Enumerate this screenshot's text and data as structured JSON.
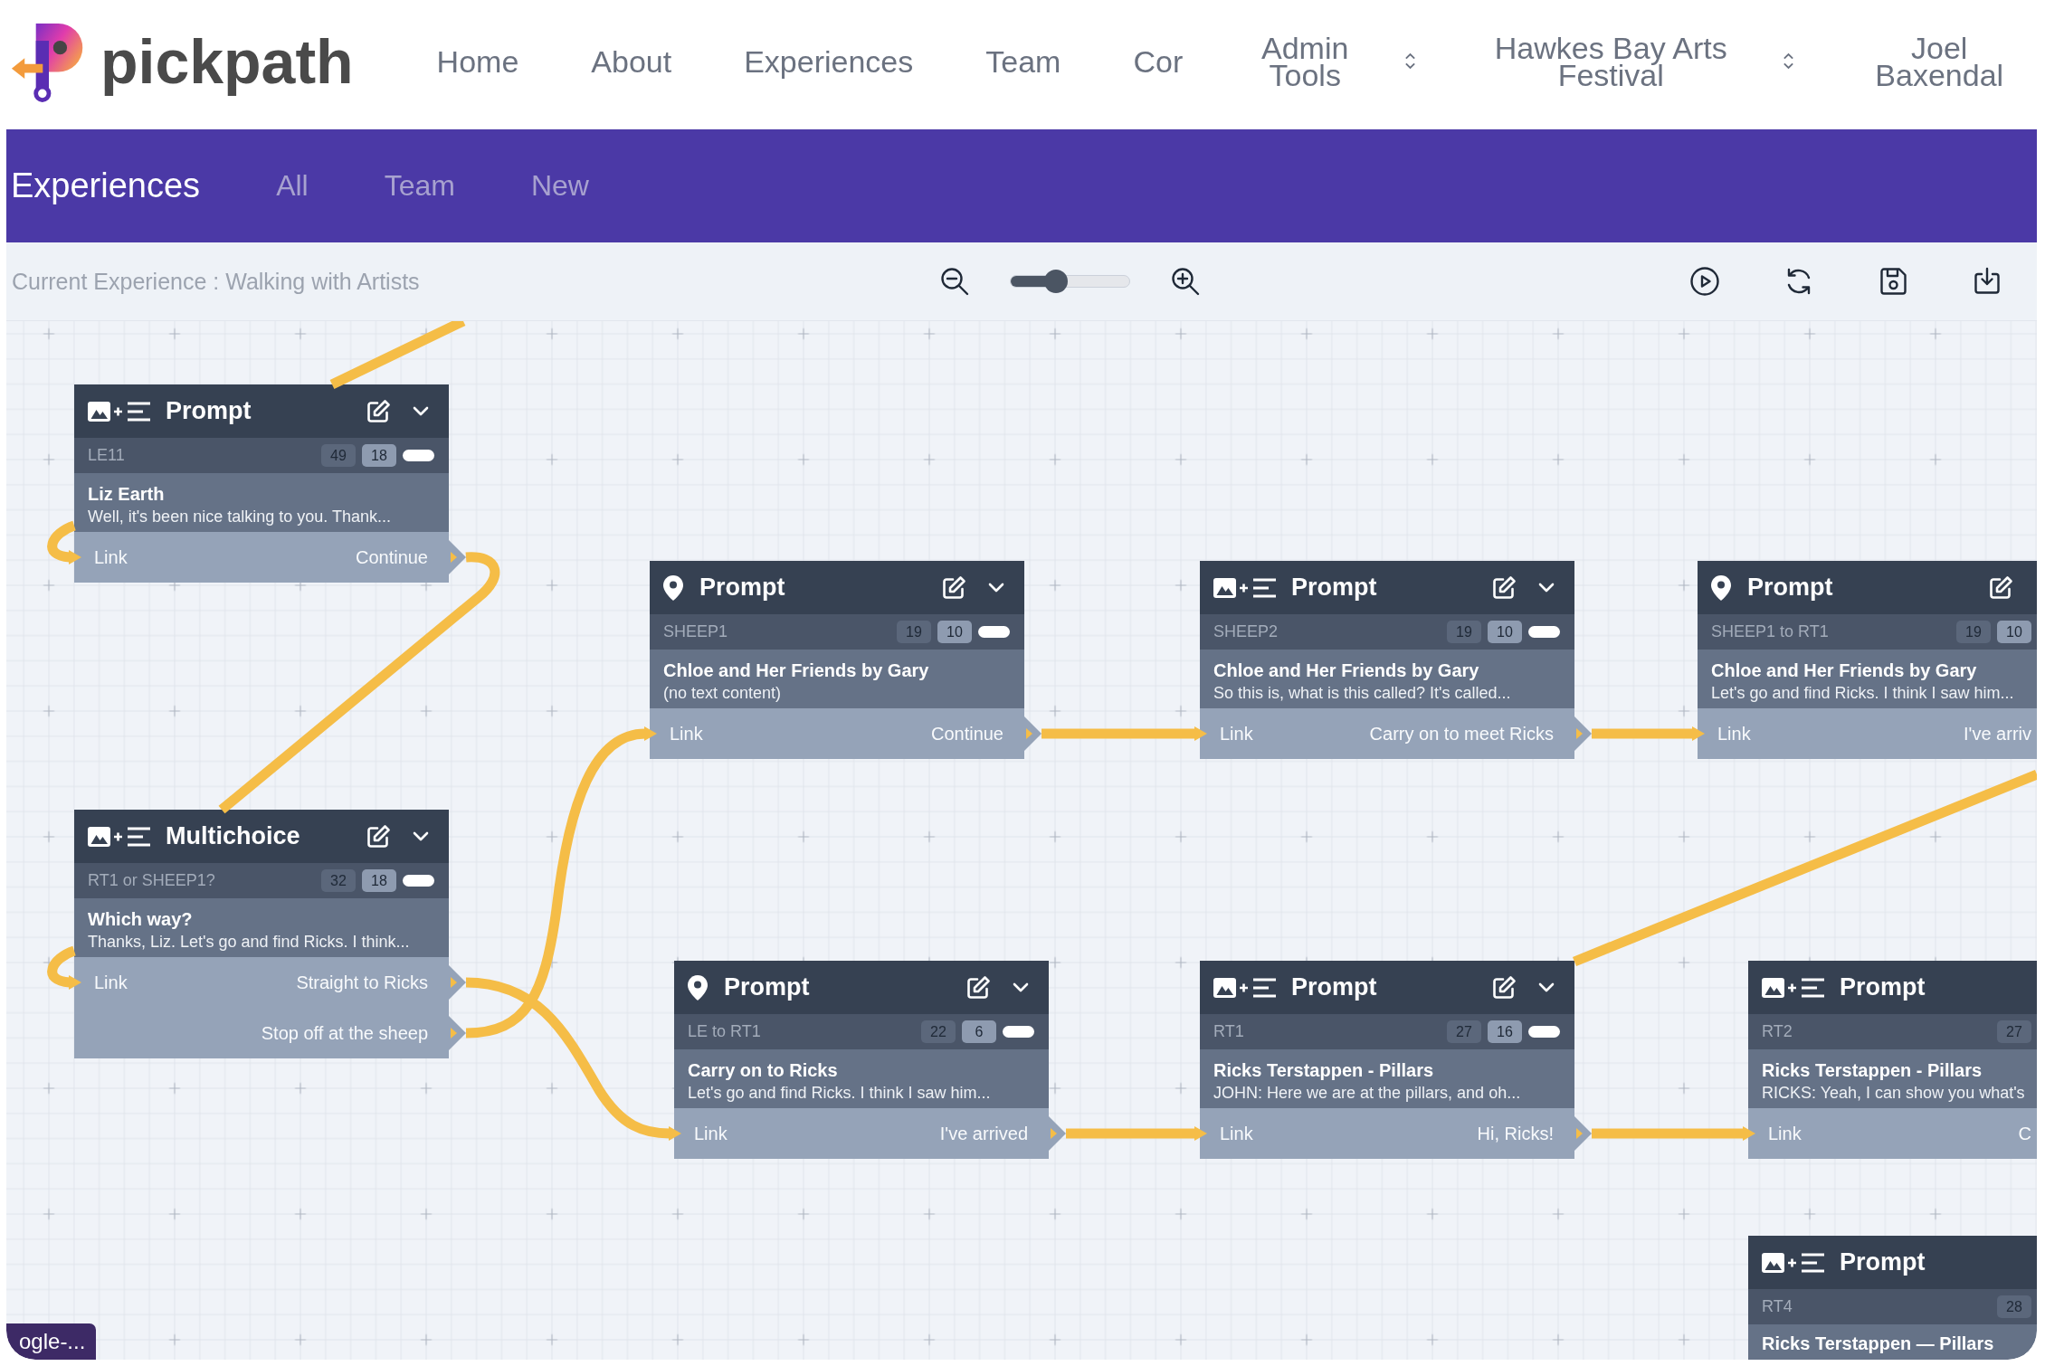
{
  "header": {
    "brand": "pickpath",
    "nav": [
      {
        "label": "Home",
        "kind": "link"
      },
      {
        "label": "About",
        "kind": "link"
      },
      {
        "label": "Experiences",
        "kind": "link"
      },
      {
        "label": "Team",
        "kind": "link"
      },
      {
        "label": "Cor",
        "kind": "link"
      },
      {
        "label": "Admin Tools",
        "kind": "dropdown"
      },
      {
        "label": "Hawkes Bay Arts Festival",
        "kind": "dropdown"
      },
      {
        "label": "Joel Baxendal",
        "kind": "link"
      }
    ]
  },
  "subnav": {
    "title": "Experiences",
    "tabs": [
      "All",
      "Team",
      "New"
    ]
  },
  "toolbar": {
    "current_experience": "Current Experience : Walking with Artists",
    "zoom": {
      "level": 0.38
    }
  },
  "nodes": [
    {
      "kind": "media",
      "type": "Prompt",
      "code": "LE11",
      "counts": [
        "49",
        "18"
      ],
      "enabled": true,
      "heading": "Liz Earth",
      "text": "Well, it's been nice talking to you. Thank...",
      "links": [
        {
          "label": "Link",
          "option": "Continue"
        }
      ]
    },
    {
      "kind": "location",
      "type": "Prompt",
      "code": "SHEEP1",
      "counts": [
        "19",
        "10"
      ],
      "enabled": true,
      "heading": "Chloe and Her Friends by Gary",
      "text": "(no text content)",
      "links": [
        {
          "label": "Link",
          "option": "Continue"
        }
      ]
    },
    {
      "kind": "media",
      "type": "Prompt",
      "code": "SHEEP2",
      "counts": [
        "19",
        "10"
      ],
      "enabled": true,
      "heading": "Chloe and Her Friends by Gary",
      "text": "So this is, what is this called? It's called...",
      "links": [
        {
          "label": "Link",
          "option": "Carry on to meet Ricks"
        }
      ]
    },
    {
      "kind": "location",
      "type": "Prompt",
      "code": "SHEEP1 to RT1",
      "counts": [
        "19",
        "10"
      ],
      "heading": "Chloe and Her Friends by Gary",
      "text": "Let's go and find Ricks. I think I saw him...",
      "links": [
        {
          "label": "Link",
          "option": "I've arriv"
        }
      ]
    },
    {
      "kind": "media",
      "type": "Multichoice",
      "code": "RT1 or SHEEP1?",
      "counts": [
        "32",
        "18"
      ],
      "enabled": true,
      "heading": "Which way?",
      "text": "Thanks, Liz. Let's go and find Ricks. I think...",
      "links": [
        {
          "label": "Link",
          "option": "Straight to Ricks"
        },
        {
          "option": "Stop off at the sheep"
        }
      ]
    },
    {
      "kind": "location",
      "type": "Prompt",
      "code": "LE to RT1",
      "counts": [
        "22",
        "6"
      ],
      "enabled": true,
      "heading": "Carry on to Ricks",
      "text": "Let's go and find Ricks. I think I saw him...",
      "links": [
        {
          "label": "Link",
          "option": "I've arrived"
        }
      ]
    },
    {
      "kind": "media",
      "type": "Prompt",
      "code": "RT1",
      "counts": [
        "27",
        "16"
      ],
      "enabled": true,
      "heading": "Ricks Terstappen - Pillars",
      "text": "JOHN: Here we are at the pillars, and oh...",
      "links": [
        {
          "label": "Link",
          "option": "Hi, Ricks!"
        }
      ]
    },
    {
      "kind": "media",
      "type": "Prompt",
      "code": "RT2",
      "counts": [
        "27"
      ],
      "heading": "Ricks Terstappen - Pillars",
      "text": "RICKS: Yeah, I can show you what's",
      "links": [
        {
          "label": "Link",
          "option": "C"
        }
      ]
    },
    {
      "kind": "media",
      "type": "Prompt",
      "code": "RT4",
      "counts": [
        "28"
      ],
      "heading": "Ricks Terstappen — Pillars"
    }
  ],
  "bottom_tab": {
    "label": "ogle-..."
  }
}
